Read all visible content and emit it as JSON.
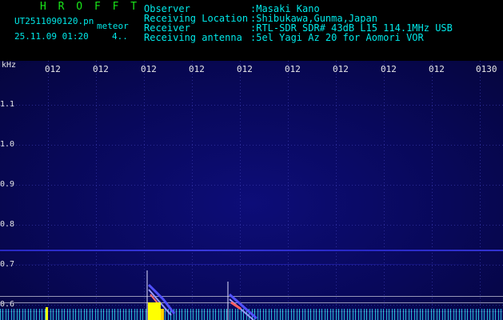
{
  "header": {
    "brand": "H R O F F T",
    "filename": "UT2511090120.pn",
    "tag": "meteor",
    "date": "25.11.09 01:20",
    "extra": "4..",
    "info": [
      {
        "label": "Observer",
        "value": ":Masaki Kano"
      },
      {
        "label": "Receiving Location",
        "value": ":Shibukawa,Gunma,Japan"
      },
      {
        "label": "Receiver",
        "value": ":RTL-SDR SDR# 43dB L15 114.1MHz USB"
      },
      {
        "label": "Receiving antenna",
        "value": ":5el Yagi Az 20 for Aomori VOR"
      }
    ]
  },
  "plot": {
    "unit": "kHz",
    "y_ticks": [
      "1.1",
      "1.0",
      "0.9",
      "0.8",
      "0.7",
      "0.6"
    ],
    "x_ticks": [
      "012",
      "012",
      "012",
      "012",
      "012",
      "012",
      "012",
      "012",
      "012",
      "0130"
    ]
  },
  "colors": {
    "header_text": "#00e8e8",
    "brand": "#19e619",
    "background": "#08085a",
    "meteor_echo": "#ffff00"
  }
}
